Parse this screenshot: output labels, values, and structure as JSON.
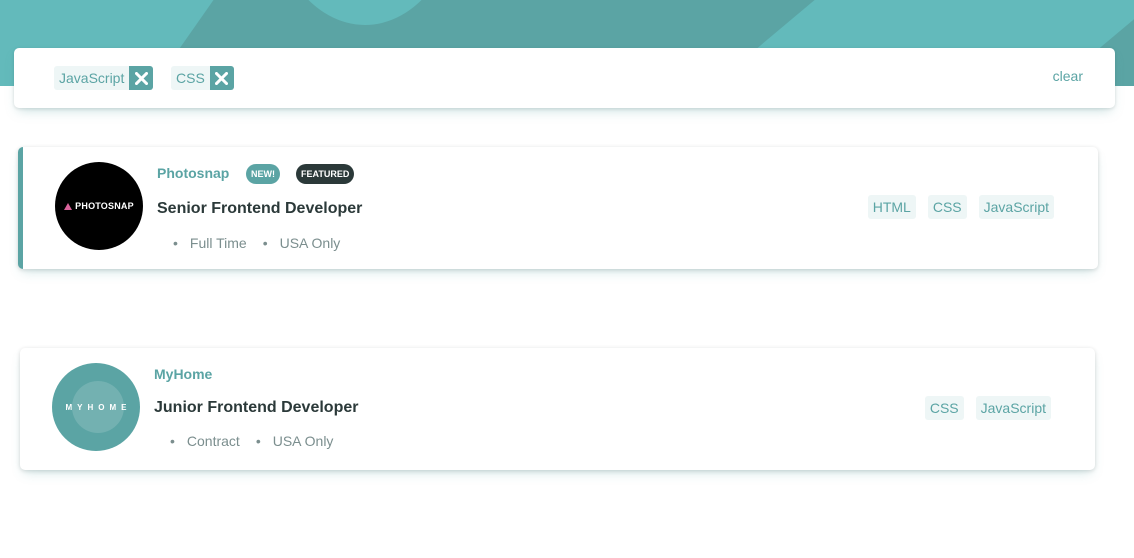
{
  "filters": {
    "chips": [
      {
        "label": "JavaScript",
        "remove_icon": "close-icon"
      },
      {
        "label": "CSS",
        "remove_icon": "close-icon"
      }
    ],
    "clear_label": "clear"
  },
  "jobs": [
    {
      "company": "Photosnap",
      "logo_text": "PHOTOSNAP",
      "badge_new": "NEW!",
      "badge_featured": "FEATURED",
      "position": "Senior Frontend Developer",
      "contract": "Full Time",
      "location": "USA Only",
      "tags": [
        "HTML",
        "CSS",
        "JavaScript"
      ]
    },
    {
      "company": "MyHome",
      "logo_text": "MYHOME",
      "position": "Junior Frontend Developer",
      "contract": "Contract",
      "location": "USA Only",
      "tags": [
        "CSS",
        "JavaScript"
      ]
    }
  ],
  "colors": {
    "primary": "#5ba4a4",
    "dark": "#2b3939",
    "tag_bg": "#eef6f6",
    "muted": "#7b8e8e"
  }
}
